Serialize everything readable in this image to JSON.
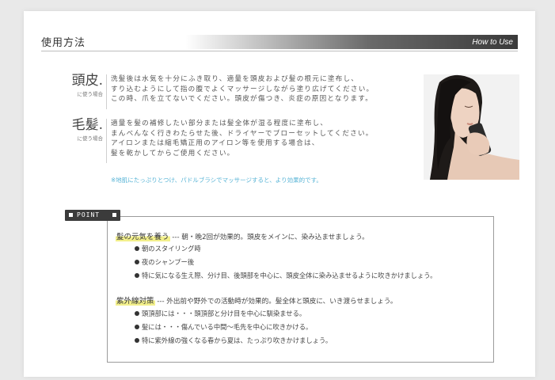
{
  "header": {
    "title": "使用方法",
    "subtitle_en": "How to Use"
  },
  "scalp": {
    "label": "頭皮.",
    "sub": "に使う場合",
    "lines": [
      "洗髪後は水気を十分にふき取り、適量を頭皮および髪の根元に塗布し、",
      "すり込むようにして指の腹でよくマッサージしながら塗り広げてください。",
      "この時、爪を立てないでください。頭皮が傷つき、炎症の原因となります。"
    ]
  },
  "hair": {
    "label": "毛髪.",
    "sub": "に使う場合",
    "lines": [
      "適量を髪の補修したい部分または髪全体が湿る程度に塗布し、",
      "まんべんなく行きわたらせた後、ドライヤーでブローセットしてください。",
      "アイロンまたは縮毛矯正用のアイロン等を使用する場合は、",
      "髪を乾かしてからご使用ください。"
    ]
  },
  "note": "※地肌にたっぷりとつけ、パドルブラシでマッサージすると、より効果的です。",
  "point": {
    "tag": "POINT",
    "sections": [
      {
        "heading": "髪の元気を養う",
        "desc": " --- 朝・晩2回が効果的。頭皮をメインに、染み込ませましょう。",
        "bullets": [
          "朝のスタイリング時",
          "夜のシャンプー後",
          "特に気になる生え際、分け目、後頭部を中心に、頭皮全体に染み込ませるように吹きかけましょう。"
        ]
      },
      {
        "heading": "紫外線対策",
        "desc": " --- 外出前や野外での活動時が効果的。髪全体と頭皮に、いき渡らせましょう。",
        "bullets": [
          "頭頂部には・・・頭頂部と分け目を中心に馴染ませる。",
          "髪には・・・傷んでいる中間〜毛先を中心に吹きかける。",
          "特に紫外線の強くなる春から夏は、たっぷり吹きかけましょう。"
        ]
      }
    ]
  },
  "colors": {
    "note": "#58b4d6",
    "highlight": "#f3f08c",
    "tag_bg": "#3b3b3b"
  }
}
